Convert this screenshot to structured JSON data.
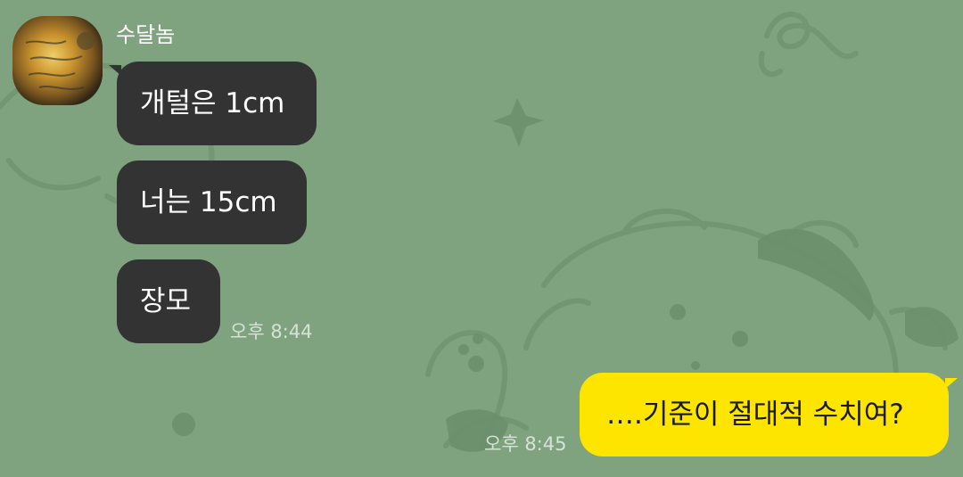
{
  "chat": {
    "sender": {
      "name": "수달놈",
      "avatar_icon": "profile-photo"
    },
    "received_messages": [
      {
        "text": "개털은 1cm"
      },
      {
        "text": "너는 15cm"
      },
      {
        "text": "장모"
      }
    ],
    "received_time": "오후 8:44",
    "sent_message": {
      "text": "….기준이 절대적 수치여?"
    },
    "sent_time": "오후 8:45"
  },
  "colors": {
    "background": "#7fa37f",
    "received_bubble": "#333333",
    "sent_bubble": "#fee500",
    "doodle_lines": "#6b8f6b"
  }
}
